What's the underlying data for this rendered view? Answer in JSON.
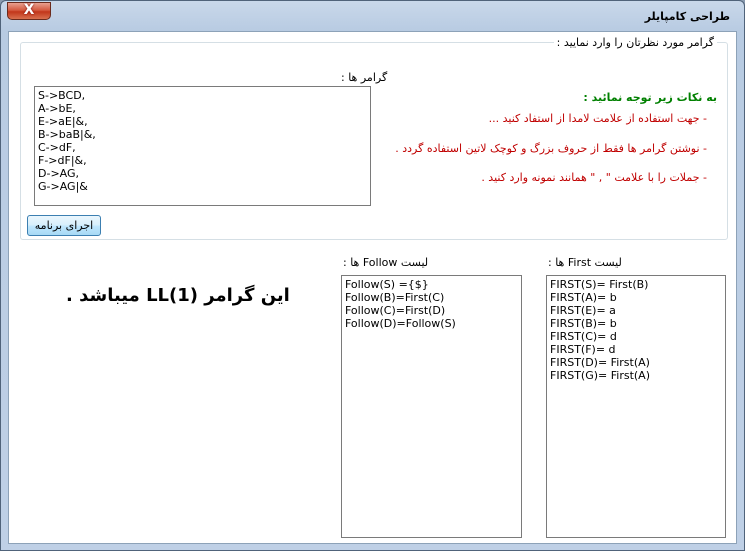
{
  "window": {
    "title": "طراحی کامپایلر",
    "close_symbol": "X"
  },
  "group": {
    "caption": "گرامر مورد نظرتان را وارد نمایید :"
  },
  "grammar": {
    "label": "گرامر ها :",
    "lines": [
      "S->BCD,",
      "A->bE,",
      "E->aE|&,",
      "B->baB|&,",
      "C->dF,",
      "F->dF|&,",
      "D->AG,",
      "G->AG|&"
    ]
  },
  "notes": {
    "title": "به نکات زیر توجه نمائید :",
    "items": [
      "- جهت استفاده از علامت لامدا از  استفاد کنید ...",
      "- نوشتن گرامر ها فقط از حروف بزرگ و کوچک لاتین استفاده گردد .",
      "- جملات را با علامت \" , \" همانند نمونه وارد کنید ."
    ]
  },
  "run_button": {
    "label": "اجرای برنامه"
  },
  "first": {
    "label": "لیست  First ها :",
    "lines": [
      "FIRST(S)= First(B)",
      "FIRST(A)= b",
      "FIRST(E)= a",
      "FIRST(B)= b",
      "FIRST(C)= d",
      "FIRST(F)= d",
      "FIRST(D)= First(A)",
      "FIRST(G)= First(A)"
    ]
  },
  "follow": {
    "label": "لیست  Follow ها :",
    "lines": [
      "Follow(S) ={$}",
      "Follow(B)=First(C)",
      "Follow(C)=First(D)",
      "Follow(D)=Follow(S)"
    ]
  },
  "result": {
    "text": "این گرامر LL(1) میباشد ."
  }
}
